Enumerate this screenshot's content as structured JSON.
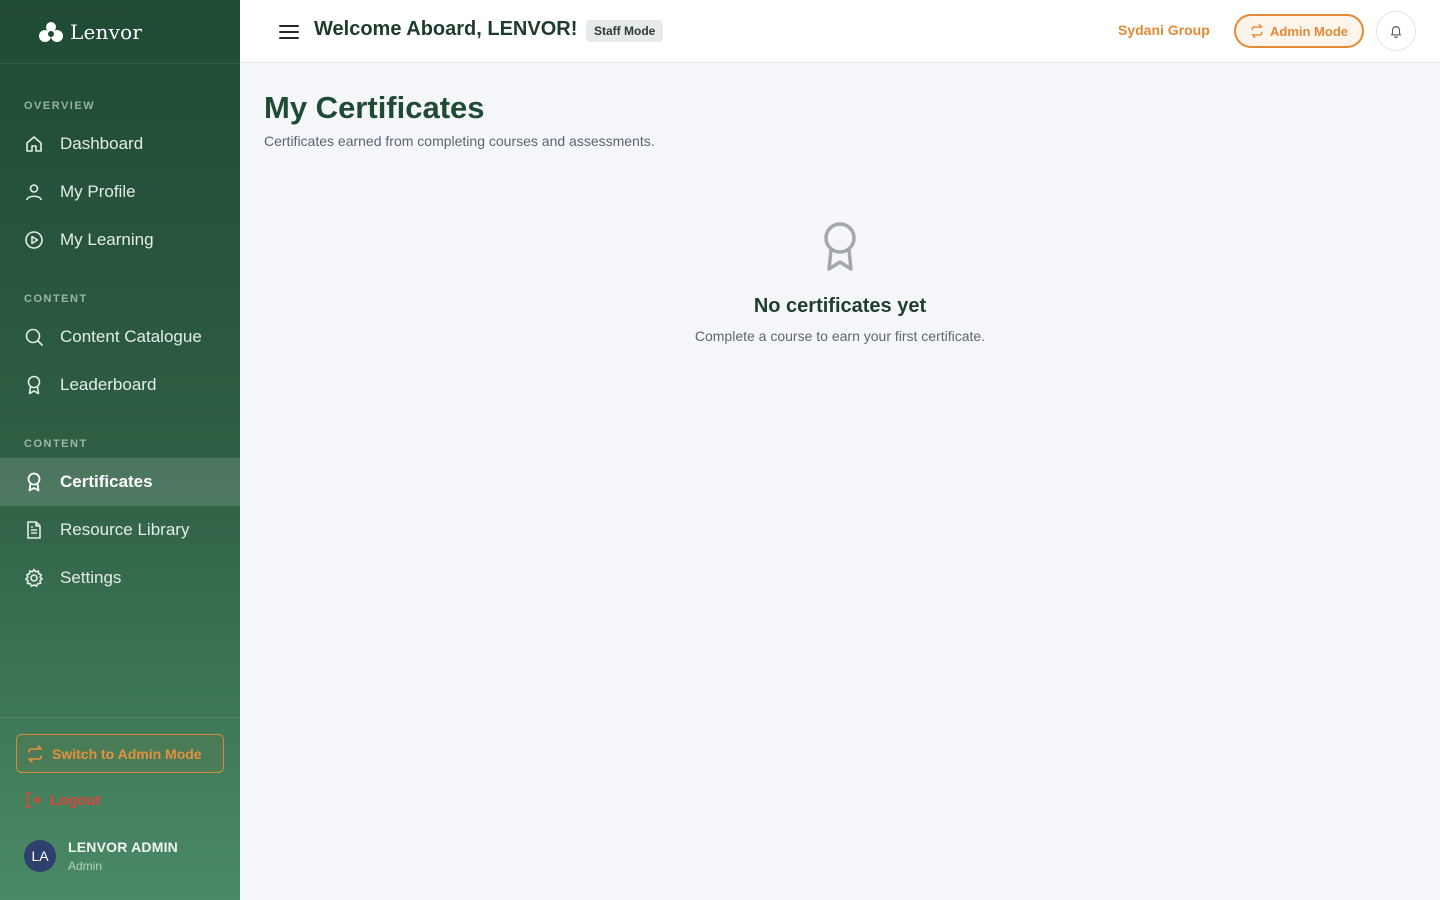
{
  "brand": {
    "name": "Lenvor"
  },
  "sidebar": {
    "sections": [
      "OVERVIEW",
      "CONTENT",
      "CONTENT"
    ],
    "items": [
      {
        "label": "Dashboard",
        "icon": "home-icon"
      },
      {
        "label": "My Profile",
        "icon": "user-icon"
      },
      {
        "label": "My Learning",
        "icon": "play-circle-icon"
      },
      {
        "label": "Content Catalogue",
        "icon": "search-icon"
      },
      {
        "label": "Leaderboard",
        "icon": "award-icon"
      },
      {
        "label": "Certificates",
        "icon": "award-icon",
        "active": true
      },
      {
        "label": "Resource Library",
        "icon": "document-icon"
      },
      {
        "label": "Settings",
        "icon": "gear-icon"
      }
    ],
    "switch_label": "Switch to Admin Mode",
    "logout_label": "Logout",
    "user": {
      "initials": "LA",
      "name": "LENVOR ADMIN",
      "role": "Admin"
    }
  },
  "header": {
    "welcome": "Welcome Aboard, LENVOR!",
    "mode_badge": "Staff Mode",
    "org": "Sydani Group",
    "admin_label": "Admin Mode"
  },
  "main": {
    "title": "My Certificates",
    "subtitle": "Certificates earned from completing courses and assessments.",
    "empty_title": "No certificates yet",
    "empty_subtitle": "Complete a course to earn your first certificate."
  },
  "colors": {
    "accent": "#e28a35",
    "brand_green": "#1f4a33",
    "danger": "#d9483b"
  }
}
